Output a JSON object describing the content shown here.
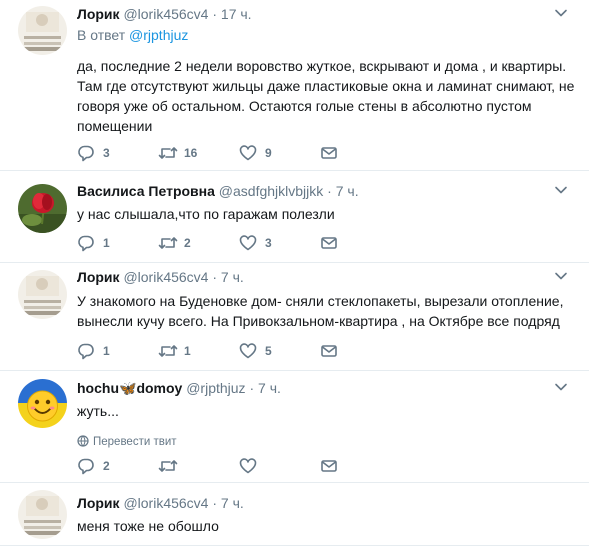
{
  "tweets": [
    {
      "name": "Лорик",
      "handle": "@lorik456cv4",
      "separator": "·",
      "time": "17 ч.",
      "reply_prefix": "В ответ",
      "reply_handle": "@rjpthjuz",
      "text": "да, последние 2 недели воровство жуткое, вскрывают и дома , и квартиры. Там где отсутствуют жильцы даже пластиковые окна и ламинат снимают, не говоря  уже об остальном. Остаются голые стены в абсолютно пустом помещении",
      "replies": "3",
      "retweets": "16",
      "likes": "9"
    },
    {
      "name": "Василиса Петровна",
      "handle": "@asdfghjklvbjjkk",
      "separator": "·",
      "time": "7 ч.",
      "text": "у нас слышала,что по гаражам полезли",
      "replies": "1",
      "retweets": "2",
      "likes": "3"
    },
    {
      "name": "Лорик",
      "handle": "@lorik456cv4",
      "separator": "·",
      "time": "7 ч.",
      "text": "У знакомого на Буденовке дом- сняли стеклопакеты, вырезали отопление, вынесли кучу всего. На Привокзальном-квартира , на Октябре все подряд",
      "replies": "1",
      "retweets": "1",
      "likes": "5"
    },
    {
      "name_part1": "hochu",
      "name_emoji": "🦋",
      "name_part2": "domoy",
      "handle": "@rjpthjuz",
      "separator": "·",
      "time": "7 ч.",
      "text": "жуть...",
      "translate": "Перевести твит",
      "replies": "2",
      "retweets": "",
      "likes": ""
    },
    {
      "name": "Лорик",
      "handle": "@lorik456cv4",
      "separator": "·",
      "time": "7 ч.",
      "text": "меня тоже не обошло"
    }
  ],
  "icons": {
    "reply": "reply-icon",
    "retweet": "retweet-icon",
    "like": "heart-icon",
    "dm": "envelope-icon",
    "caret": "chevron-down-icon",
    "translate": "globe-icon"
  },
  "colors": {
    "text": "#14171a",
    "muted": "#657786",
    "link": "#1b95e0",
    "divider": "#e6ecf0"
  }
}
